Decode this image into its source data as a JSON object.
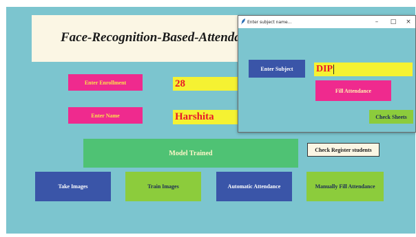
{
  "main": {
    "title": "Face-Recognition-Based-Attendanc",
    "enrollment_label": "Enter Enrollment",
    "enrollment_value": "28",
    "name_label": "Enter Name",
    "name_value": "Harshita",
    "status": "Model Trained",
    "check_register_label": "Check Register students",
    "buttons": {
      "take_images": "Take Images",
      "train_images": "Train Images",
      "automatic_attendance": "Automatic Attendance",
      "manual_attendance": "Manually Fill Attendance"
    }
  },
  "dialog": {
    "title": "Enter subject name...",
    "subject_label": "Enter Subject",
    "subject_value": "DIP",
    "fill_attendance": "Fill Attendance",
    "check_sheets": "Check Sheets",
    "controls": {
      "minimize": "–",
      "maximize": "□",
      "close": "×"
    }
  },
  "colors": {
    "background": "#7cc5cf",
    "pink": "#ef2a8e",
    "yellow": "#f5f232",
    "green": "#4fc274",
    "blue": "#3a55a8",
    "lime": "#8ccc3c",
    "cream": "#fbf6e4"
  },
  "icons": {
    "window_icon": "feather-icon"
  }
}
